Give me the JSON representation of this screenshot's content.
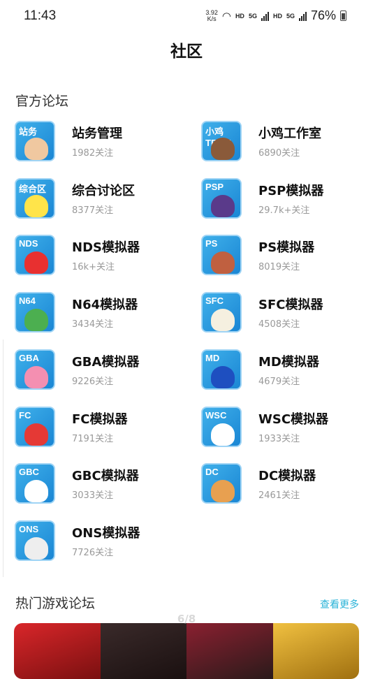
{
  "status": {
    "time": "11:43",
    "speed": "3.92",
    "speed_unit": "K/s",
    "hd1": "HD",
    "net1": "5G",
    "hd2": "HD",
    "net2": "5G",
    "battery": "76%"
  },
  "title": "社区",
  "official": {
    "section_title": "官方论坛",
    "forums": [
      {
        "badge": "站务",
        "name": "站务管理",
        "followers": "1982关注",
        "art_color": "#f0c8a0"
      },
      {
        "badge": "小鸡TEAM",
        "name": "小鸡工作室",
        "followers": "6890关注",
        "art_color": "#8a5a3a"
      },
      {
        "badge": "综合区",
        "name": "综合讨论区",
        "followers": "8377关注",
        "art_color": "#ffe44a"
      },
      {
        "badge": "PSP",
        "name": "PSP模拟器",
        "followers": "29.7k+关注",
        "art_color": "#5a3a8a"
      },
      {
        "badge": "NDS",
        "name": "NDS模拟器",
        "followers": "16k+关注",
        "art_color": "#e83030"
      },
      {
        "badge": "PS",
        "name": "PS模拟器",
        "followers": "8019关注",
        "art_color": "#c06040"
      },
      {
        "badge": "N64",
        "name": "N64模拟器",
        "followers": "3434关注",
        "art_color": "#4caf50"
      },
      {
        "badge": "SFC",
        "name": "SFC模拟器",
        "followers": "4508关注",
        "art_color": "#f5f0e0"
      },
      {
        "badge": "GBA",
        "name": "GBA模拟器",
        "followers": "9226关注",
        "art_color": "#f48fb1"
      },
      {
        "badge": "MD",
        "name": "MD模拟器",
        "followers": "4679关注",
        "art_color": "#1e4fc0"
      },
      {
        "badge": "FC",
        "name": "FC模拟器",
        "followers": "7191关注",
        "art_color": "#e53935"
      },
      {
        "badge": "WSC",
        "name": "WSC模拟器",
        "followers": "1933关注",
        "art_color": "#ffffff"
      },
      {
        "badge": "GBC",
        "name": "GBC模拟器",
        "followers": "3033关注",
        "art_color": "#ffffff"
      },
      {
        "badge": "DC",
        "name": "DC模拟器",
        "followers": "2461关注",
        "art_color": "#e8a050"
      },
      {
        "badge": "ONS",
        "name": "ONS模拟器",
        "followers": "7726关注",
        "art_color": "#eeeeee"
      }
    ]
  },
  "hot": {
    "section_title": "热门游戏论坛",
    "more_label": "查看更多",
    "pager": "6/8"
  }
}
